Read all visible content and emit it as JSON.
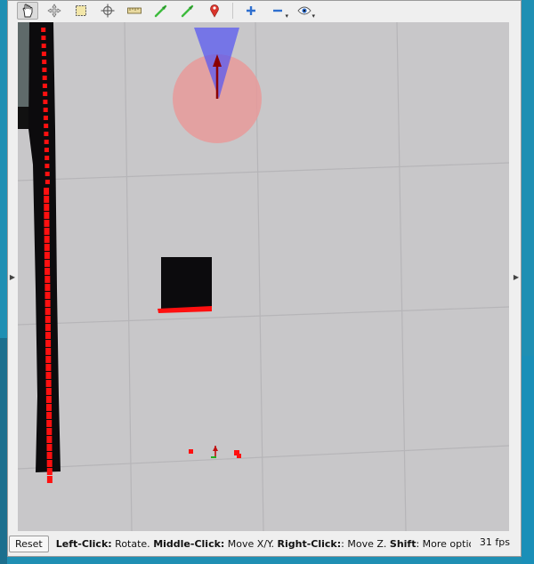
{
  "toolbar": {
    "tools": [
      {
        "name": "interact-icon",
        "active": true
      },
      {
        "name": "move-camera-icon",
        "active": false
      },
      {
        "name": "select-icon",
        "active": false
      },
      {
        "name": "focus-camera-icon",
        "active": false
      },
      {
        "name": "measure-icon",
        "active": false
      },
      {
        "name": "2d-pose-estimate-icon",
        "active": false
      },
      {
        "name": "2d-nav-goal-icon",
        "active": false
      },
      {
        "name": "publish-point-icon",
        "active": false
      }
    ],
    "view_tools": [
      {
        "name": "add-tool-icon"
      },
      {
        "name": "remove-tool-icon",
        "has_dropdown": true
      },
      {
        "name": "eye-view-icon",
        "has_dropdown": true
      }
    ],
    "colors": {
      "accent_green": "#3dbb3d",
      "accent_red": "#d9342b",
      "accent_blue": "#2f6fcf"
    }
  },
  "viewport": {
    "background": "#c8c7c9",
    "grid_color": "#b8b7ba",
    "obstacle_color": "#0c0b0d",
    "laser_color": "#ff0000",
    "robot_footprint_color": "#e89a9a",
    "camera_frustum_color": "#5a5af0"
  },
  "status": {
    "reset_label": "Reset",
    "help": [
      {
        "bold": "Left-Click:",
        "text": " Rotate. "
      },
      {
        "bold": "Middle-Click:",
        "text": " Move X/Y. "
      },
      {
        "bold": "Right-Click:",
        "text": ": Move Z. "
      },
      {
        "bold": "Shift",
        "text": ": More options."
      }
    ],
    "fps": "31 fps"
  }
}
